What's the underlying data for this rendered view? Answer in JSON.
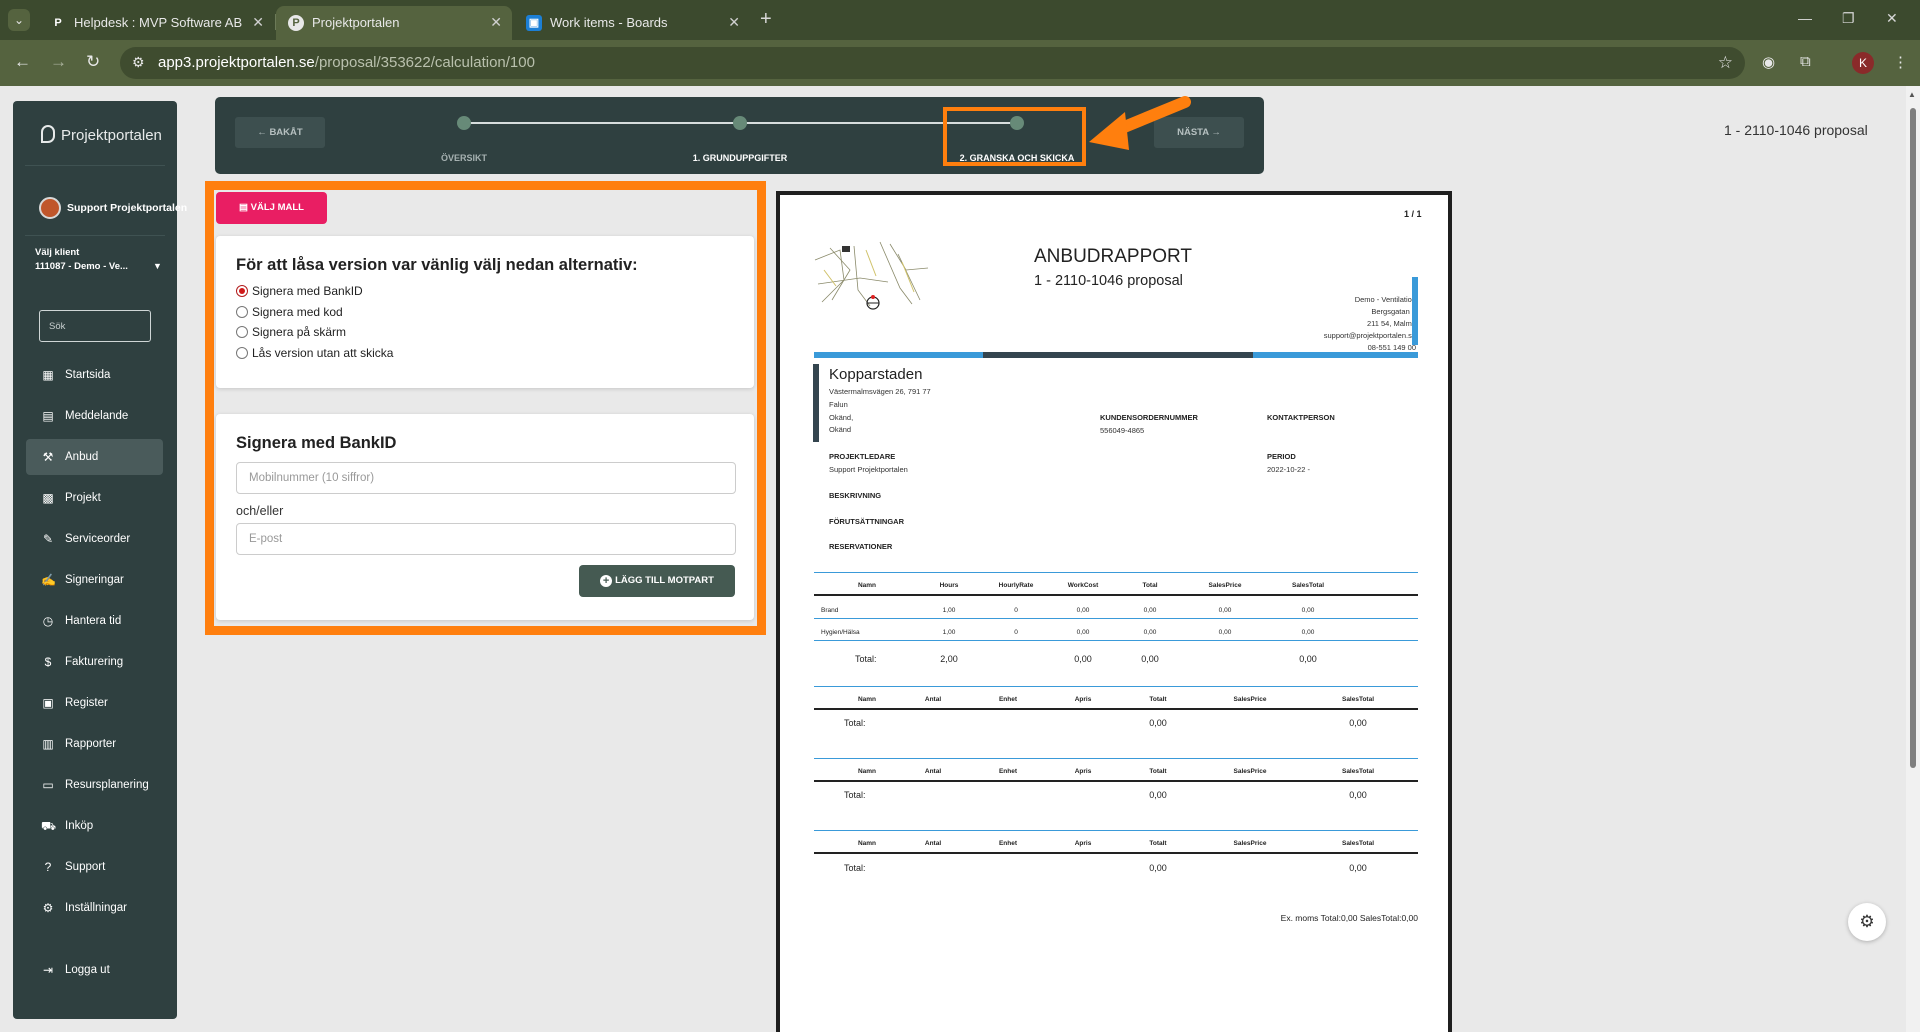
{
  "browser": {
    "tabs": [
      {
        "title": "Helpdesk : MVP Software AB",
        "favicon": "P"
      },
      {
        "title": "Projektportalen",
        "favicon": "P"
      },
      {
        "title": "Work items - Boards",
        "favicon": "azure-boards-icon"
      }
    ],
    "url_host": "app3.projektportalen.se",
    "url_path": "/proposal/353622/calculation/100",
    "profile_initial": "K"
  },
  "sidebar": {
    "brand": "Projektportalen",
    "user": "Support Projektportalen",
    "client_label": "Välj klient",
    "client_value": "111087 - Demo - Ve...",
    "search_placeholder": "Sök",
    "items": [
      {
        "label": "Startsida",
        "icon": "dashboard-icon"
      },
      {
        "label": "Meddelande",
        "icon": "message-icon"
      },
      {
        "label": "Anbud",
        "icon": "gavel-icon"
      },
      {
        "label": "Projekt",
        "icon": "grid-icon"
      },
      {
        "label": "Serviceorder",
        "icon": "wrench-icon"
      },
      {
        "label": "Signeringar",
        "icon": "signature-icon"
      },
      {
        "label": "Hantera tid",
        "icon": "clock-icon"
      },
      {
        "label": "Fakturering",
        "icon": "dollar-icon"
      },
      {
        "label": "Register",
        "icon": "register-icon"
      },
      {
        "label": "Rapporter",
        "icon": "report-icon"
      },
      {
        "label": "Resursplanering",
        "icon": "calendar-icon"
      },
      {
        "label": "Inköp",
        "icon": "cart-icon"
      },
      {
        "label": "Support",
        "icon": "help-icon"
      },
      {
        "label": "Inställningar",
        "icon": "gear-icon"
      }
    ],
    "logout": "Logga ut"
  },
  "stepper": {
    "back": "BAKÅT",
    "next": "NÄSTA",
    "steps": [
      "ÖVERSIKT",
      "1. GRUNDUPPGIFTER",
      "2. GRANSKA OCH SKICKA"
    ],
    "current_step": 3
  },
  "proposal_title": "1 - 2110-1046 proposal",
  "template_button": "VÄLJ MALL",
  "lock": {
    "heading": "För att låsa version var vänlig välj nedan alternativ:",
    "options": [
      "Signera med BankID",
      "Signera med kod",
      "Signera på skärm",
      "Lås version utan att skicka"
    ],
    "selected": "Signera med BankID"
  },
  "bankid": {
    "heading": "Signera med BankID",
    "mobile_placeholder": "Mobilnummer (10 siffror)",
    "and_or": "och/eller",
    "email_placeholder": "E-post",
    "add_button": "LÄGG TILL MOTPART"
  },
  "document": {
    "page": "1 / 1",
    "title": "ANBUDRAPPORT",
    "subtitle": "1 - 2110-1046 proposal",
    "sender": [
      "Demo - Ventilation",
      "Bergsgatan 1",
      "211 54, Malmö",
      "support@projektportalen.se",
      "08-551 149 00"
    ],
    "customer": {
      "name": "Kopparstaden",
      "lines": [
        "Västermalmsvägen 26, 791 77",
        "Falun",
        "Okänd,",
        "Okänd"
      ]
    },
    "fields": {
      "kundorder_label": "KUNDENSORDERNUMMER",
      "kundorder_value": "556049-4865",
      "kontakt_label": "KONTAKTPERSON",
      "projektledare_label": "PROJEKTLEDARE",
      "projektledare_value": "Support Projektportalen",
      "period_label": "PERIOD",
      "period_value": "2022-10-22 -",
      "beskrivning_label": "BESKRIVNING",
      "forutsattningar_label": "FÖRUTSÄTTNINGAR",
      "reservationer_label": "RESERVATIONER"
    },
    "work_table": {
      "headers": [
        "Namn",
        "Hours",
        "HourlyRate",
        "WorkCost",
        "Total",
        "SalesPrice",
        "SalesTotal"
      ],
      "rows": [
        [
          "Brand",
          "1,00",
          "0",
          "0,00",
          "0,00",
          "0,00",
          "0,00"
        ],
        [
          "Hygien/Hälsa",
          "1,00",
          "0",
          "0,00",
          "0,00",
          "0,00",
          "0,00"
        ]
      ],
      "total_label": "Total:",
      "totals": [
        "2,00",
        "0,00",
        "0,00",
        "0,00"
      ]
    },
    "item_tables": [
      {
        "headers": [
          "Namn",
          "Antal",
          "Enhet",
          "Apris",
          "Totalt",
          "SalesPrice",
          "SalesTotal"
        ],
        "total_label": "Total:",
        "totalt": "0,00",
        "salestotal": "0,00"
      },
      {
        "headers": [
          "Namn",
          "Antal",
          "Enhet",
          "Apris",
          "Totalt",
          "SalesPrice",
          "SalesTotal"
        ],
        "total_label": "Total:",
        "totalt": "0,00",
        "salestotal": "0,00"
      },
      {
        "headers": [
          "Namn",
          "Antal",
          "Enhet",
          "Apris",
          "Totalt",
          "SalesPrice",
          "SalesTotal"
        ],
        "total_label": "Total:",
        "totalt": "0,00",
        "salestotal": "0,00"
      }
    ],
    "summary": "Ex. moms Total:0,00 SalesTotal:0,00"
  },
  "colors": {
    "sidebar": "#2f4040",
    "accent_pink": "#e91e63",
    "highlight_orange": "#ff7f0e",
    "browser_frame": "#55633f",
    "doc_blue": "#3a9ad9",
    "doc_dark": "#34454f"
  }
}
